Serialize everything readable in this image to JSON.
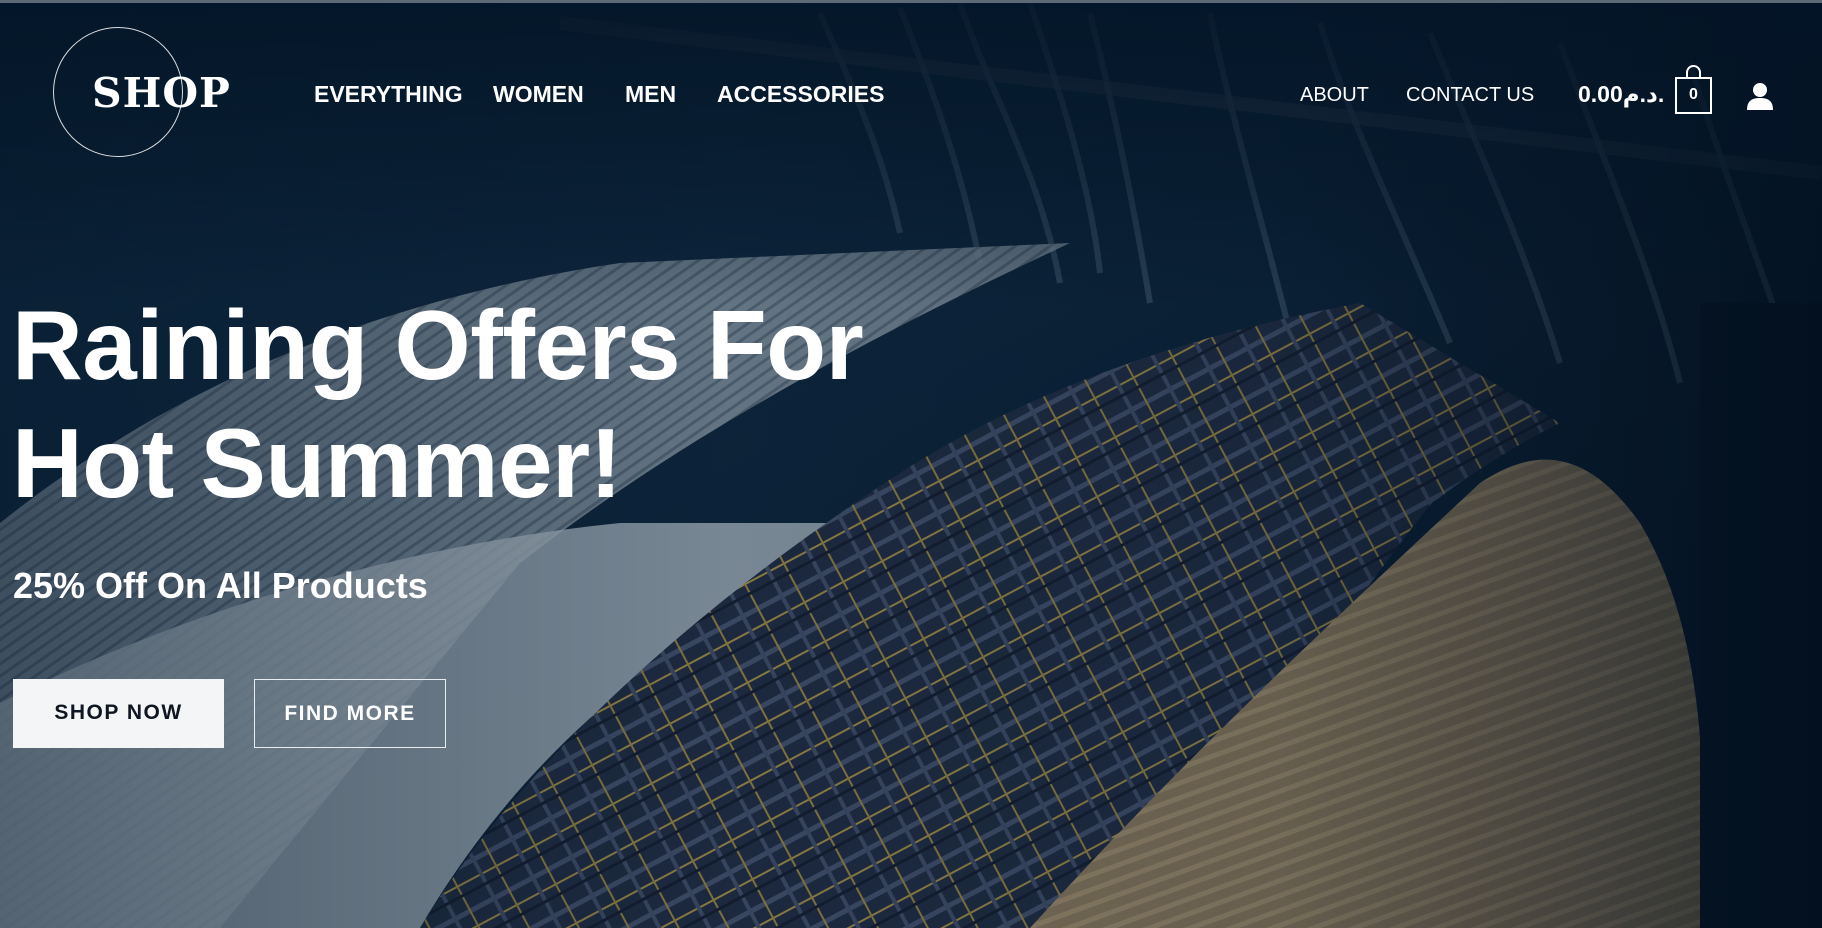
{
  "brand": {
    "logo_text": "SHOP"
  },
  "nav": {
    "left": [
      "EVERYTHING",
      "WOMEN",
      "MEN",
      "ACCESSORIES"
    ],
    "right": [
      "ABOUT",
      "CONTACT US"
    ]
  },
  "cart": {
    "amount": "0.00د.م.",
    "count": "0",
    "icon": "shopping-bag-icon"
  },
  "account": {
    "icon": "user-icon"
  },
  "hero": {
    "headline_line1": "Raining Offers For",
    "headline_line2": "Hot Summer!",
    "subheadline": "25% Off On All Products",
    "primary_button": "SHOP NOW",
    "secondary_button": "FIND MORE"
  },
  "colors": {
    "overlay": "#041628",
    "button_light": "#f4f5f6",
    "text": "#ffffff"
  }
}
